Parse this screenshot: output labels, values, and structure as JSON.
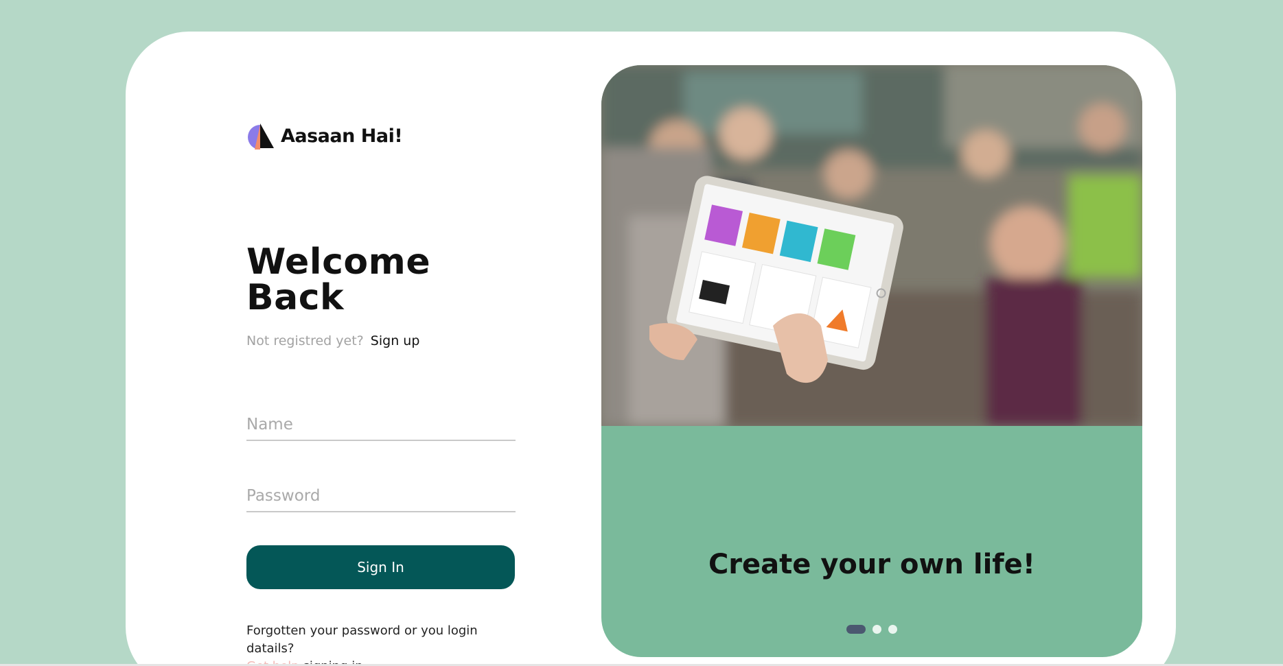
{
  "brand": {
    "name": "Aasaan Hai!",
    "logo_icon": "sail-logo-icon"
  },
  "login": {
    "heading": "Welcome Back",
    "signup_prompt": "Not registred yet?",
    "signup_link": "Sign up",
    "name_placeholder": "Name",
    "password_placeholder": "Password",
    "signin_label": "Sign In",
    "help_text": "Forgotten your password or you login datails?",
    "help_link": "Get help",
    "help_suffix": "signing in"
  },
  "promo": {
    "tagline": "Create your own life!",
    "slides": 3,
    "active_slide": 1
  },
  "colors": {
    "page_background": "#b5d8c7",
    "primary_button": "#045757",
    "promo_panel": "#7aba9b",
    "help_link": "#f3b9b6",
    "dot_active": "#4b5870"
  }
}
